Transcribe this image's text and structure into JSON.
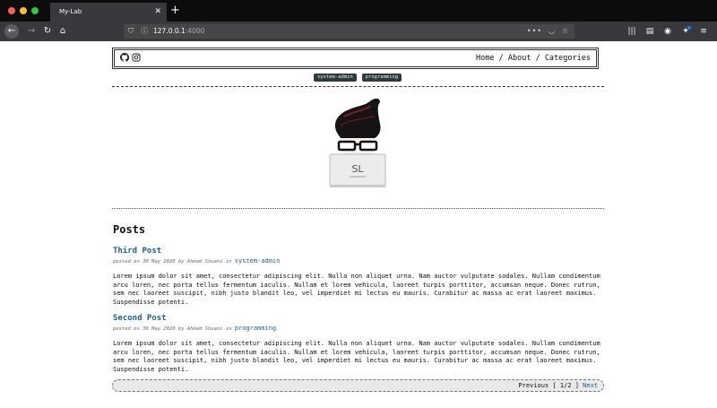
{
  "browser": {
    "tab_title": "My-Lab",
    "tab_close": "✕",
    "new_tab": "+",
    "url_host": "127.0.0.1",
    "url_port": ":4000",
    "colors": {
      "close": "#ff5f57",
      "minimize": "#febc2e",
      "maximize": "#28c840"
    }
  },
  "header": {
    "social": [
      "github-icon",
      "instagram-icon"
    ],
    "menu": [
      "Home",
      "About",
      "Categories"
    ],
    "separator": " / "
  },
  "tags": [
    "system-admin",
    "programming"
  ],
  "logo": {
    "text": "SL"
  },
  "posts_heading": "Posts",
  "posts": [
    {
      "title": "Third Post",
      "meta_prefix": "posted on 30 May 2020 by Ahmad Shuani in ",
      "category": "system-admin",
      "excerpt": "Lorem ipsum dolor sit amet, consectetur adipiscing elit. Nulla non aliquet urna. Nam auctor vulputate sodales. Nullam condimentum arcu loren, nec porta tellus fermentum iaculis. Nullam et lorem vehicula, laoreet turpis porttitor, accumsan neque. Donec rutrun, sem nec laoreet suscipit, nibh justo blandit leo, vel imperdiet mi lectus eu mauris. Curabitur ac massa ac erat laoreet maximus. Suspendisse potenti."
    },
    {
      "title": "Second Post",
      "meta_prefix": "posted on 30 May 2020 by Ahmad Shuani in ",
      "category": "programming",
      "excerpt": "Lorem ipsum dolor sit amet, consectetur adipiscing elit. Nulla non aliquet urna. Nam auctor vulputate sodales. Nullam condimentum arcu loren, nec porta tellus fermentum iaculis. Nullam et lorem vehicula, laoreet turpis porttitor, accumsan neque. Donec rutrun, sem nec laoreet suscipit, nibh justo blandit leo, vel imperdiet mi lectus eu mauris. Curabitur ac massa ac erat laoreet maximus. Suspendisse potenti."
    }
  ],
  "pagination": {
    "previous": "Previous",
    "page": "[ 1/2 ]",
    "next": "Next"
  }
}
